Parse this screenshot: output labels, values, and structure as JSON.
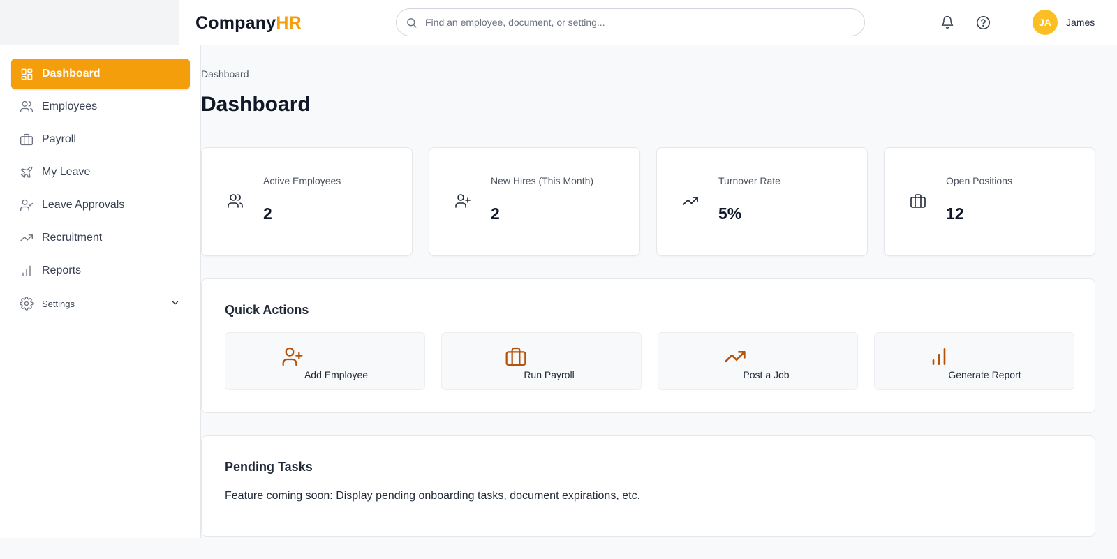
{
  "brand": {
    "name_part1": "Company",
    "name_part2": "HR"
  },
  "search": {
    "placeholder": "Find an employee, document, or setting..."
  },
  "user": {
    "initials": "JA",
    "name": "James"
  },
  "colors": {
    "accent": "#f59e0b",
    "avatar": "#fbbf24",
    "action_icon": "#b45309"
  },
  "sidebar": {
    "items": [
      {
        "label": "Dashboard",
        "icon": "dashboard-icon",
        "active": true
      },
      {
        "label": "Employees",
        "icon": "users-icon"
      },
      {
        "label": "Payroll",
        "icon": "briefcase-icon"
      },
      {
        "label": "My Leave",
        "icon": "plane-icon"
      },
      {
        "label": "Leave Approvals",
        "icon": "user-check-icon"
      },
      {
        "label": "Recruitment",
        "icon": "trending-up-icon"
      },
      {
        "label": "Reports",
        "icon": "bar-chart-icon"
      },
      {
        "label": "Settings",
        "icon": "gear-icon",
        "expandable": true
      }
    ]
  },
  "breadcrumb": "Dashboard",
  "page_title": "Dashboard",
  "stats": [
    {
      "label": "Active Employees",
      "value": "2",
      "icon": "users-icon"
    },
    {
      "label": "New Hires (This Month)",
      "value": "2",
      "icon": "user-plus-icon"
    },
    {
      "label": "Turnover Rate",
      "value": "5%",
      "icon": "trending-up-icon"
    },
    {
      "label": "Open Positions",
      "value": "12",
      "icon": "briefcase-icon"
    }
  ],
  "quick_actions": {
    "title": "Quick Actions",
    "items": [
      {
        "label": "Add Employee",
        "icon": "user-plus-icon"
      },
      {
        "label": "Run Payroll",
        "icon": "briefcase-icon"
      },
      {
        "label": "Post a Job",
        "icon": "trending-up-icon"
      },
      {
        "label": "Generate Report",
        "icon": "bar-chart-icon"
      }
    ]
  },
  "pending_tasks": {
    "title": "Pending Tasks",
    "text": "Feature coming soon: Display pending onboarding tasks, document expirations, etc."
  }
}
